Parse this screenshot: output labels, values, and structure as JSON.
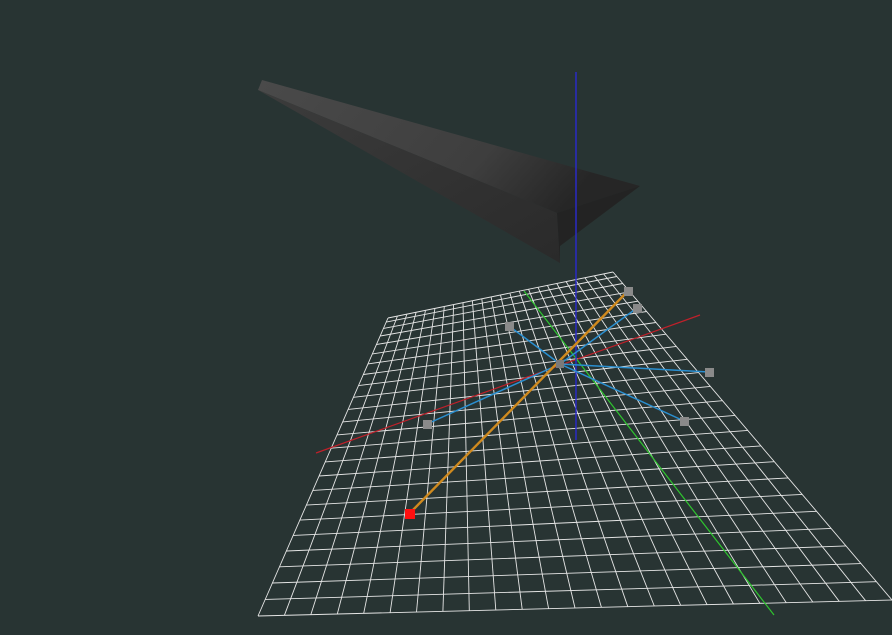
{
  "scene": {
    "background": "#283433",
    "grid_color": "#e6e6e6",
    "axis_colors": {
      "x": "#c0202a",
      "y": "#2fc52f",
      "z": "#2a2ad0"
    },
    "ray_color": "#2a8fd0",
    "selected_ray_color": "#d08a1e",
    "handle_color": "#8a8a8a",
    "selected_handle_color": "#ff1010",
    "object": "dark-wedge-mesh",
    "handles_total": 6,
    "selected_handle_index": 0
  }
}
